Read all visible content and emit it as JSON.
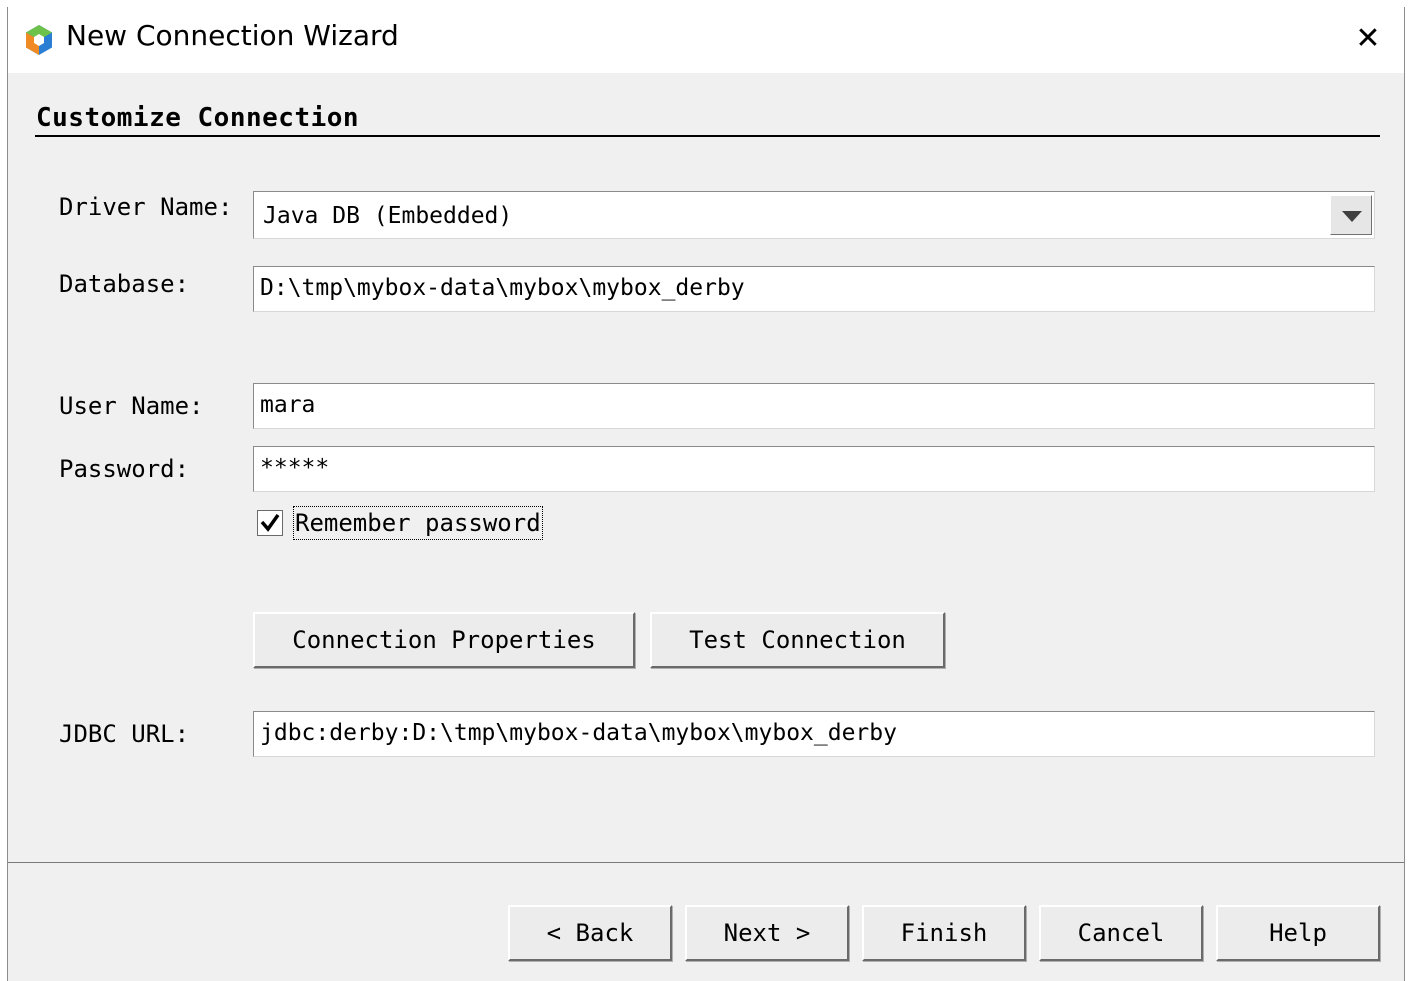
{
  "window": {
    "title": "New Connection Wizard",
    "close_glyph": "✕",
    "app_icon": "netbeans-cube-icon"
  },
  "section": {
    "title": "Customize Connection"
  },
  "form": {
    "driver": {
      "label": "Driver Name:",
      "value": "Java DB (Embedded)"
    },
    "database": {
      "label": "Database:",
      "value": "D:\\tmp\\mybox-data\\mybox\\mybox_derby"
    },
    "user": {
      "label": "User Name:",
      "value": "mara"
    },
    "password": {
      "label": "Password:",
      "value": "*****"
    },
    "remember": {
      "label": "Remember password",
      "checked": true
    },
    "jdbc": {
      "label": "JDBC URL:",
      "value": "jdbc:derby:D:\\tmp\\mybox-data\\mybox\\mybox_derby"
    }
  },
  "buttons": {
    "connection_properties": "Connection Properties",
    "test_connection": "Test Connection",
    "back": "< Back",
    "next": "Next >",
    "finish": "Finish",
    "cancel": "Cancel",
    "help": "Help"
  }
}
